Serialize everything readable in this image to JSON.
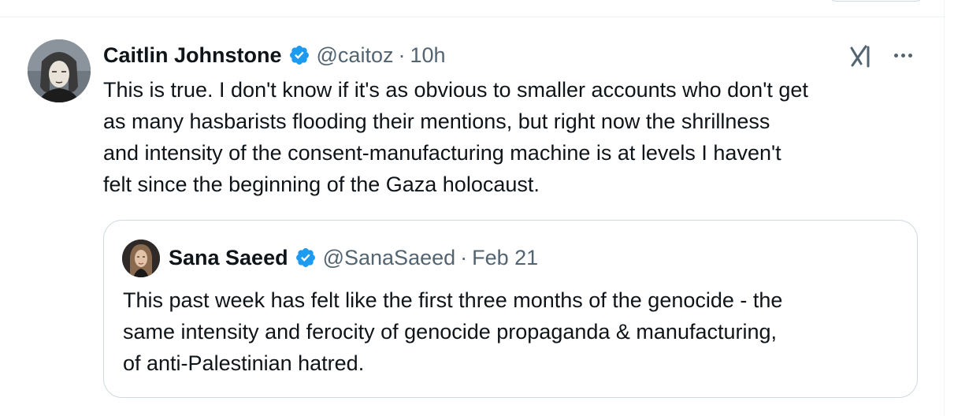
{
  "tweet": {
    "author_name": "Caitlin Johnstone",
    "handle": "@caitoz",
    "separator": "·",
    "time": "10h",
    "verified_icon": "verified-badge-icon",
    "text_lines": [
      "This is true. I don't know if it's as obvious to smaller accounts who don't get",
      "as many hasbarists flooding their mentions, but right now the shrillness",
      "and intensity of the consent-manufacturing machine is at levels I haven't",
      "felt since the beginning of the Gaza holocaust."
    ],
    "actions": {
      "grok_icon": "grok-icon",
      "more_icon": "more-dots-icon"
    }
  },
  "quote": {
    "author_name": "Sana Saeed",
    "handle": "@SanaSaeed",
    "separator": "·",
    "time": "Feb 21",
    "verified_icon": "verified-badge-icon",
    "text_lines": [
      "This past week has felt like the first three months of the genocide - the",
      "same intensity and ferocity of genocide propaganda & manufacturing,",
      "of anti-Palestinian hatred."
    ]
  },
  "colors": {
    "text_primary": "#0f1419",
    "text_secondary": "#536471",
    "verified_blue": "#1d9bf0",
    "border": "#cfd9de"
  }
}
